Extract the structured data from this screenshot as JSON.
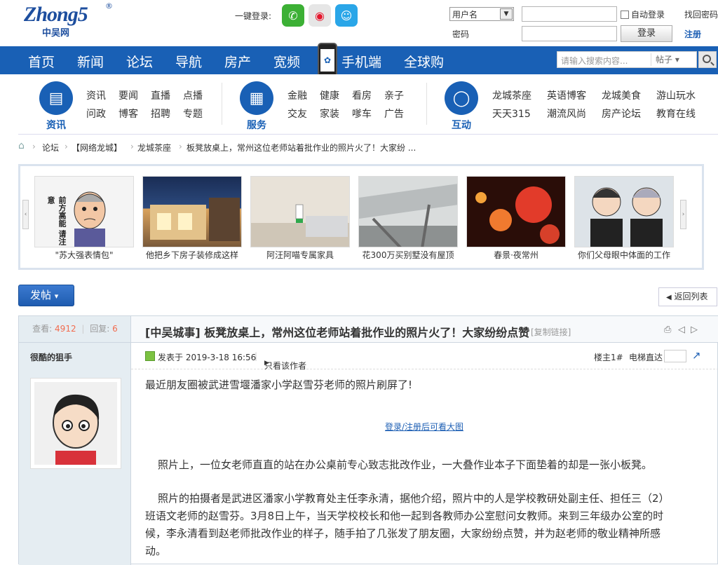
{
  "header": {
    "logo_text": "Zhong5",
    "logo_cn": "中吴网",
    "logo_reg": "®",
    "one_key_login": "一键登录:",
    "login": {
      "username_select": "用户名",
      "password_label": "密码",
      "auto_login": "自动登录",
      "login_button": "登录",
      "find_password": "找回密码",
      "register": "注册"
    }
  },
  "nav": {
    "items": [
      "首页",
      "新闻",
      "论坛",
      "导航",
      "房产",
      "宽频",
      "手机端",
      "全球购"
    ],
    "search_placeholder": "请输入搜索内容...",
    "search_scope": "帖子"
  },
  "categories": {
    "groups": [
      {
        "label": "资讯",
        "links": [
          "资讯",
          "要闻",
          "直播",
          "点播",
          "问政",
          "博客",
          "招聘",
          "专题"
        ]
      },
      {
        "label": "服务",
        "links": [
          "金融",
          "健康",
          "看房",
          "亲子",
          "交友",
          "家装",
          "嗲车",
          "广告"
        ]
      },
      {
        "label": "互动",
        "links": [
          "龙城茶座",
          "英语博客",
          "龙城美食",
          "游山玩水",
          "天天315",
          "潮流风尚",
          "房产论坛",
          "教育在线"
        ]
      }
    ]
  },
  "breadcrumb": [
    "论坛",
    "【网络龙城】",
    "龙城茶座",
    "板凳放桌上，常州这位老师站着批作业的照片火了！大家纷 ..."
  ],
  "gallery": [
    {
      "caption": "\"苏大强表情包\"",
      "sticker_text": "前方高能 请注意"
    },
    {
      "caption": "他把乡下房子装修成这样"
    },
    {
      "caption": "阿汪阿喵专属家具"
    },
    {
      "caption": "花300万买别墅没有屋顶"
    },
    {
      "caption": "春景·夜常州"
    },
    {
      "caption": "你们父母眼中体面的工作"
    }
  ],
  "actions": {
    "post_button": "发帖",
    "post_arrow": "▾",
    "back_to_list": "返回列表"
  },
  "thread": {
    "views_label": "查看:",
    "views": "4912",
    "sep": "|",
    "replies_label": "回复:",
    "replies": "6",
    "title": "[中吴城事] 板凳放桌上，常州这位老师站着批作业的照片火了！大家纷纷点赞",
    "copy_link": "[复制链接]",
    "author": "很酷的狙手",
    "posted_label": "发表于 2019-3-18 16:56",
    "only_author": "只看该作者",
    "floor": "楼主1#",
    "elevator": "电梯直达",
    "body": {
      "p1": "最近朋友圈被武进雪堰潘家小学赵雪芬老师的照片刷屏了!",
      "view_large": "登录/注册后可看大图",
      "p2": "照片上，一位女老师直直的站在办公桌前专心致志批改作业，一大叠作业本子下面垫着的却是一张小板凳。",
      "p3_l1": "照片的拍摄者是武进区潘家小学教育处主任李永清，据他介绍，照片中的人是学校教研处副主任、担任三（2）",
      "p3_l2": "班语文老师的赵雪芬。3月8日上午，当天学校校长和他一起到各教师办公室慰问女教师。来到三年级办公室的时",
      "p3_l3": "候，李永清看到赵老师批改作业的样子，随手拍了几张发了朋友圈，大家纷纷点赞，并为赵老师的敬业精神所感",
      "p3_l4": "动。"
    }
  },
  "colors": {
    "brand": "#1960b5",
    "accent": "#f26c4f"
  }
}
